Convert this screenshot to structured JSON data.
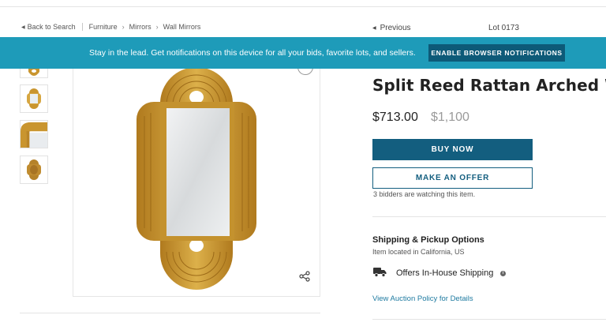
{
  "breadcrumb": {
    "back_label": "Back to Search",
    "items": [
      "Furniture",
      "Mirrors",
      "Wall Mirrors"
    ]
  },
  "lot_nav": {
    "previous_label": "Previous",
    "lot_label": "Lot 0173"
  },
  "banner": {
    "text": "Stay in the lead. Get notifications on this device for all your bids, favorite lots, and sellers.",
    "button_label": "ENABLE BROWSER NOTIFICATIONS",
    "background_color": "#1e9bb9",
    "button_color": "#0d5a78"
  },
  "product": {
    "title": "Split Reed Rattan Arched Wall Mirror",
    "price": "$713.00",
    "original_price": "$1,100",
    "buy_label": "BUY NOW",
    "offer_label": "MAKE AN OFFER",
    "watching_text": "3 bidders are watching this item.",
    "accent_color": "#135e7f"
  },
  "shipping": {
    "title": "Shipping & Pickup Options",
    "location": "Item located in California, US",
    "offer_text": "Offers In-House Shipping",
    "policy_link": "View Auction Policy for Details"
  },
  "icons": {
    "back": "caret-left-icon",
    "zoom": "zoom-icon",
    "share": "share-icon",
    "truck": "truck-icon",
    "info": "info-icon"
  }
}
